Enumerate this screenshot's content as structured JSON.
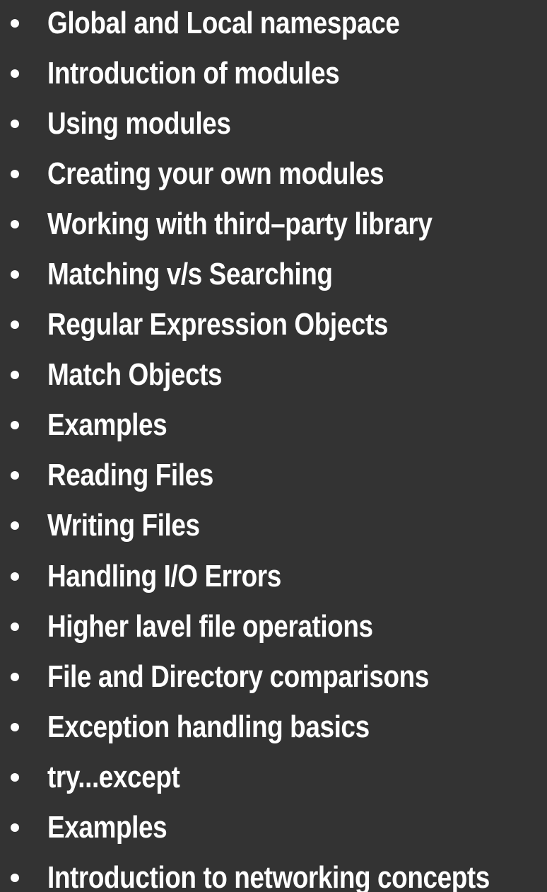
{
  "topics": [
    {
      "label": "Global and Local namespace"
    },
    {
      "label": "Introduction of modules"
    },
    {
      "label": "Using modules"
    },
    {
      "label": "Creating your own modules"
    },
    {
      "label": "Working with third–party library"
    },
    {
      "label": "Matching v/s Searching"
    },
    {
      "label": "Regular Expression Objects"
    },
    {
      "label": "Match Objects"
    },
    {
      "label": "Examples"
    },
    {
      "label": "Reading Files"
    },
    {
      "label": "Writing Files"
    },
    {
      "label": "Handling I/O Errors"
    },
    {
      "label": "Higher lavel file operations"
    },
    {
      "label": "File and Directory comparisons"
    },
    {
      "label": "Exception handling basics"
    },
    {
      "label": "try...except"
    },
    {
      "label": "Examples"
    },
    {
      "label": "Introduction to networking concepts"
    }
  ]
}
